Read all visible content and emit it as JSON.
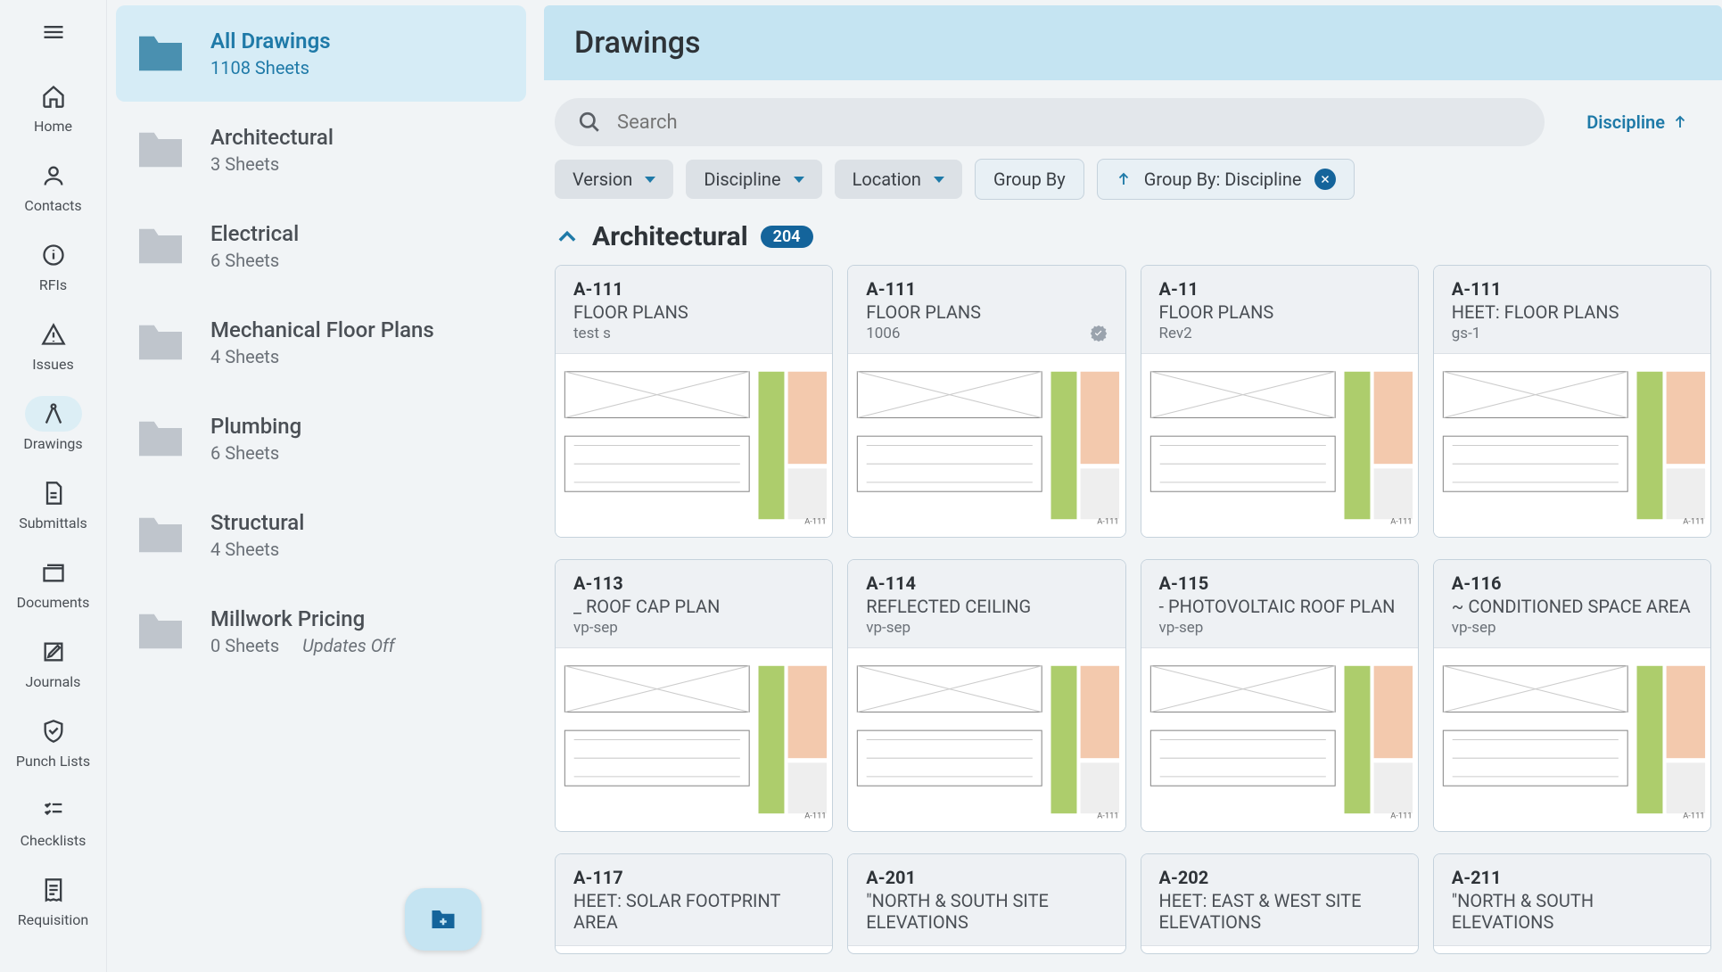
{
  "nav": {
    "items": [
      {
        "label": "Home",
        "icon": "home"
      },
      {
        "label": "Contacts",
        "icon": "person"
      },
      {
        "label": "RFIs",
        "icon": "info"
      },
      {
        "label": "Issues",
        "icon": "warning"
      },
      {
        "label": "Drawings",
        "icon": "compass",
        "active": true
      },
      {
        "label": "Submittals",
        "icon": "file"
      },
      {
        "label": "Documents",
        "icon": "folders"
      },
      {
        "label": "Journals",
        "icon": "edit"
      },
      {
        "label": "Punch Lists",
        "icon": "shield-check"
      },
      {
        "label": "Checklists",
        "icon": "checklist"
      },
      {
        "label": "Requisition",
        "icon": "receipt"
      }
    ]
  },
  "folders": {
    "items": [
      {
        "title": "All Drawings",
        "sub": "1108 Sheets",
        "active": true
      },
      {
        "title": "Architectural",
        "sub": "3 Sheets"
      },
      {
        "title": "Electrical",
        "sub": "6 Sheets"
      },
      {
        "title": "Mechanical Floor Plans",
        "sub": "4 Sheets"
      },
      {
        "title": "Plumbing",
        "sub": "6 Sheets"
      },
      {
        "title": "Structural",
        "sub": "4 Sheets"
      },
      {
        "title": "Millwork Pricing",
        "sub": "0 Sheets",
        "extra": "Updates Off"
      }
    ]
  },
  "main": {
    "title": "Drawings",
    "search_placeholder": "Search",
    "sort_label": "Discipline",
    "chips": {
      "version": "Version",
      "discipline": "Discipline",
      "location": "Location",
      "group_by": "Group By",
      "group_by_active": "Group By: Discipline"
    },
    "group": {
      "title": "Architectural",
      "count": "204"
    },
    "cards": [
      {
        "num": "A-111",
        "title": "FLOOR PLANS",
        "sub": "test s"
      },
      {
        "num": "A-111",
        "title": "FLOOR PLANS",
        "sub": "1006",
        "verified": true
      },
      {
        "num": "A-11",
        "title": "FLOOR PLANS",
        "sub": "Rev2"
      },
      {
        "num": "A-111",
        "title": "HEET: FLOOR PLANS",
        "sub": "gs-1"
      },
      {
        "num": "A-113",
        "title": "_ ROOF CAP PLAN",
        "sub": "vp-sep"
      },
      {
        "num": "A-114",
        "title": "REFLECTED CEILING",
        "sub": "vp-sep"
      },
      {
        "num": "A-115",
        "title": "- PHOTOVOLTAIC ROOF PLAN",
        "sub": "vp-sep"
      },
      {
        "num": "A-116",
        "title": "~ CONDITIONED SPACE AREA",
        "sub": "vp-sep"
      },
      {
        "num": "A-117",
        "title": "HEET: SOLAR FOOTPRINT AREA",
        "sub": ""
      },
      {
        "num": "A-201",
        "title": "\"NORTH & SOUTH SITE ELEVATIONS",
        "sub": ""
      },
      {
        "num": "A-202",
        "title": "HEET: EAST & WEST SITE ELEVATIONS",
        "sub": ""
      },
      {
        "num": "A-211",
        "title": "\"NORTH & SOUTH ELEVATIONS",
        "sub": ""
      }
    ]
  }
}
